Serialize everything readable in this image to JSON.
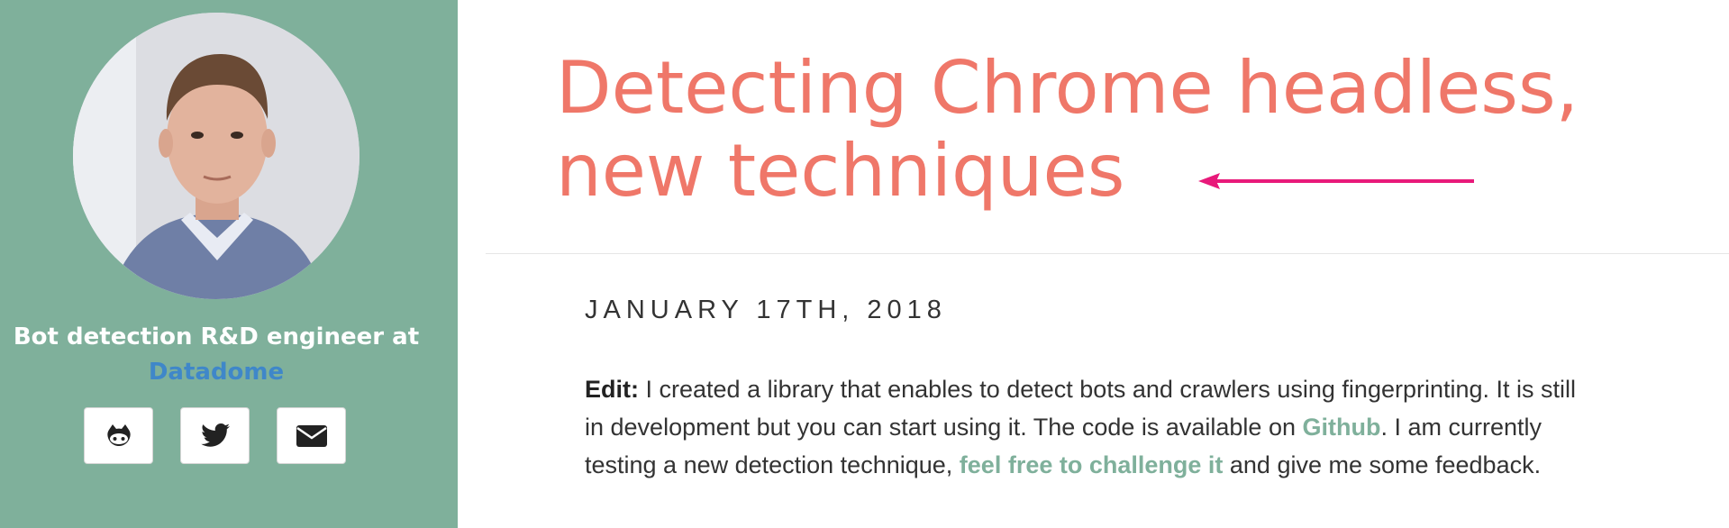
{
  "sidebar": {
    "tagline": "Bot detection R&D engineer at",
    "company_link": "Datadome",
    "social": [
      {
        "name": "github",
        "icon": "github-icon"
      },
      {
        "name": "twitter",
        "icon": "twitter-icon"
      },
      {
        "name": "email",
        "icon": "envelope-icon"
      }
    ],
    "background_color": "#7fb09b",
    "link_color": "#3f87c9"
  },
  "post": {
    "title_line1": "Detecting Chrome headless,",
    "title_line2": "new techniques",
    "title_color": "#ef7769",
    "annotation_arrow_color": "#e8197a",
    "date": "JANUARY 17TH, 2018",
    "edit_label": "Edit:",
    "para_part1": " I created a library that enables to detect bots and crawlers using fingerprinting. It is still in development but you can start using it. The code is available on ",
    "github_link": "Github",
    "para_part2": ". I am currently testing a new detection technique, ",
    "challenge_link": "feel free to challenge it",
    "para_part3": " and give me some feedback.",
    "link_color": "#7fb09b"
  }
}
